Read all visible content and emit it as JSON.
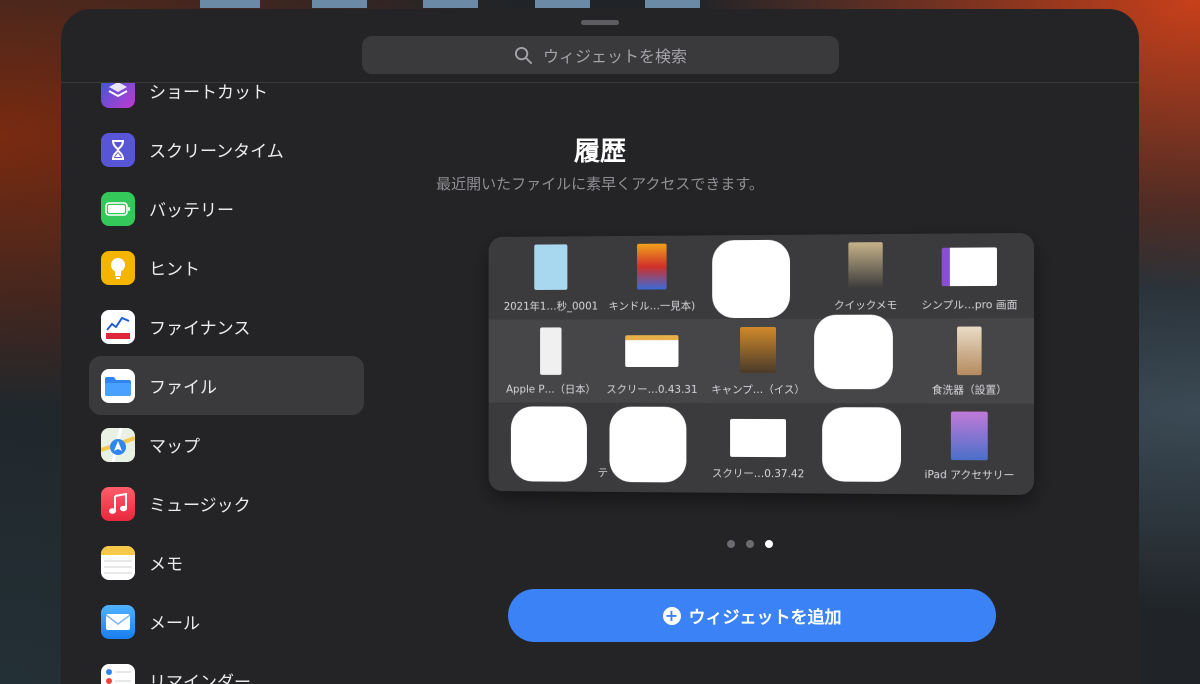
{
  "search": {
    "placeholder": "ウィジェットを検索",
    "icon": "search-icon"
  },
  "sidebar": {
    "items": [
      {
        "label": "ショートカット",
        "icon": "shortcuts-icon",
        "color": "#3b3f8f",
        "selected": false
      },
      {
        "label": "スクリーンタイム",
        "icon": "hourglass-icon",
        "color": "#5856d6",
        "selected": false
      },
      {
        "label": "バッテリー",
        "icon": "battery-icon",
        "color": "#34c759",
        "selected": false
      },
      {
        "label": "ヒント",
        "icon": "lightbulb-icon",
        "color": "#f5b400",
        "selected": false
      },
      {
        "label": "ファイナンス",
        "icon": "yahoo-finance-icon",
        "color": "#ffffff",
        "selected": false
      },
      {
        "label": "ファイル",
        "icon": "folder-icon",
        "color": "#ffffff",
        "selected": true
      },
      {
        "label": "マップ",
        "icon": "map-icon",
        "color": "#e9f1e4",
        "selected": false
      },
      {
        "label": "ミュージック",
        "icon": "music-note-icon",
        "color": "#f0404f",
        "selected": false
      },
      {
        "label": "メモ",
        "icon": "notes-icon",
        "color": "#ffffff",
        "selected": false
      },
      {
        "label": "メール",
        "icon": "envelope-icon",
        "color": "#2d8cf0",
        "selected": false
      },
      {
        "label": "リマインダー",
        "icon": "reminders-icon",
        "color": "#ffffff",
        "selected": false
      }
    ]
  },
  "main": {
    "title": "履歴",
    "subtitle": "最近開いたファイルに素早くアクセスできます。",
    "files": [
      {
        "name": "2021年1…秒_0001",
        "redacted": false
      },
      {
        "name": "キンドル…一見本)",
        "redacted": false
      },
      {
        "name": "",
        "redacted": true
      },
      {
        "name": "クイックメモ",
        "redacted": false
      },
      {
        "name": "シンプル…pro 画面",
        "redacted": false
      },
      {
        "name": "Apple P…（日本）",
        "redacted": false
      },
      {
        "name": "スクリー…0.43.31",
        "redacted": false
      },
      {
        "name": "キャンプ…（イス）",
        "redacted": false
      },
      {
        "name": "",
        "redacted": true
      },
      {
        "name": "食洗器（設置）",
        "redacted": false
      },
      {
        "name": "",
        "redacted": true
      },
      {
        "name": "テ",
        "redacted": true
      },
      {
        "name": "スクリー…0.37.42",
        "redacted": false
      },
      {
        "name": "",
        "redacted": true
      },
      {
        "name": "iPad アクセサリー",
        "redacted": false
      }
    ],
    "page_dots": {
      "count": 3,
      "active": 3
    },
    "add_button": {
      "label": "ウィジェットを追加",
      "icon": "plus-circle-icon"
    }
  },
  "colors": {
    "accent": "#3a82f6",
    "sheet": "#242426"
  }
}
